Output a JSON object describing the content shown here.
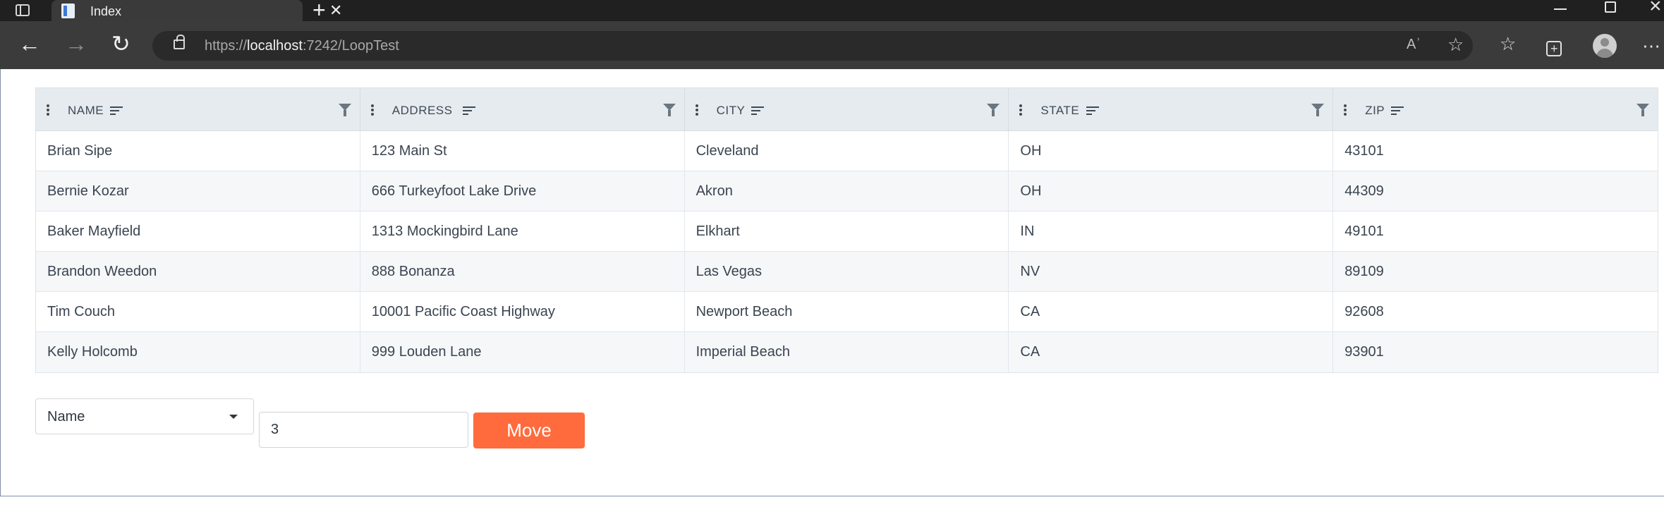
{
  "browser": {
    "tab_title": "Index",
    "url_scheme": "https://",
    "url_host": "localhost",
    "url_rest": ":7242/LoopTest",
    "read_aloud_glyph": "Aʾ"
  },
  "grid": {
    "columns": [
      {
        "label": "NAME"
      },
      {
        "label": "ADDRESS"
      },
      {
        "label": "CITY"
      },
      {
        "label": "STATE"
      },
      {
        "label": "ZIP"
      }
    ],
    "rows": [
      [
        "Brian Sipe",
        "123 Main St",
        "Cleveland",
        "OH",
        "43101"
      ],
      [
        "Bernie Kozar",
        "666 Turkeyfoot Lake Drive",
        "Akron",
        "OH",
        "44309"
      ],
      [
        "Baker Mayfield",
        "1313 Mockingbird Lane",
        "Elkhart",
        "IN",
        "49101"
      ],
      [
        "Brandon Weedon",
        "888 Bonanza",
        "Las Vegas",
        "NV",
        "89109"
      ],
      [
        "Tim Couch",
        "10001 Pacific Coast Highway",
        "Newport Beach",
        "CA",
        "92608"
      ],
      [
        "Kelly Holcomb",
        "999 Louden Lane",
        "Imperial Beach",
        "CA",
        "93901"
      ]
    ]
  },
  "controls": {
    "column_select_value": "Name",
    "index_value": "3",
    "move_label": "Move"
  },
  "colors": {
    "accent": "#ff6b3d",
    "header_bg": "#e6ebf0"
  }
}
